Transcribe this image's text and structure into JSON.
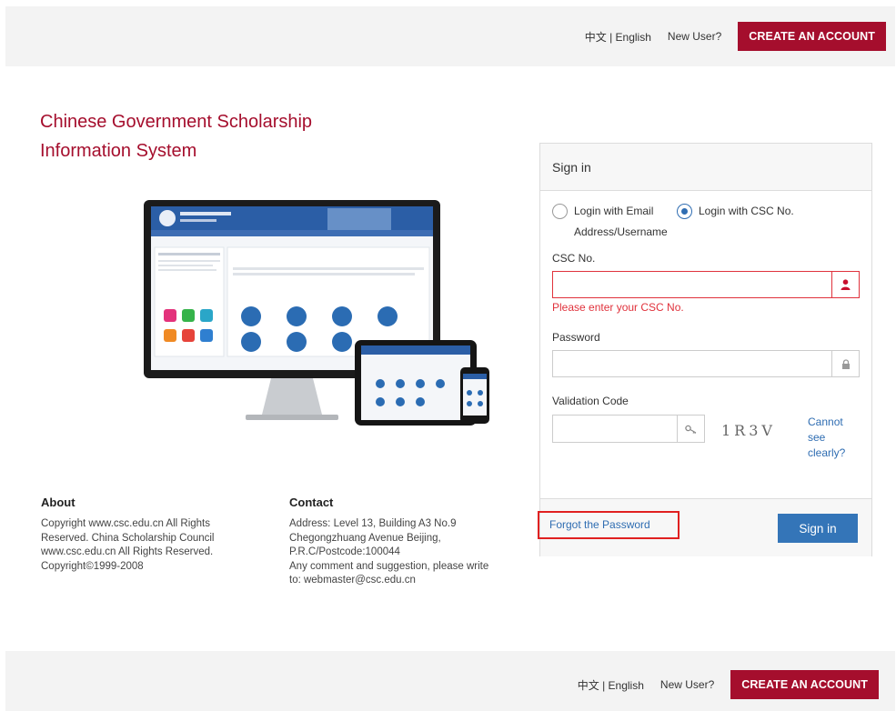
{
  "header": {
    "lang": "中文 | English",
    "new_user": "New User?",
    "create_account": "CREATE AN ACCOUNT"
  },
  "hero": {
    "title_line1": "Chinese Government Scholarship",
    "title_line2": "Information System"
  },
  "signin": {
    "heading": "Sign in",
    "radio_email_line1": "Login with Email",
    "radio_email_line2": "Address/Username",
    "radio_csc": "Login with CSC No.",
    "selected": "csc",
    "csc_label": "CSC No.",
    "csc_value": "",
    "csc_error": "Please enter your CSC No.",
    "password_label": "Password",
    "password_value": "",
    "validation_label": "Validation Code",
    "validation_value": "",
    "captcha_text": "1R3V",
    "cannot_see": "Cannot see clearly?",
    "forgot": "Forgot the Password",
    "signin_button": "Sign in"
  },
  "about": {
    "heading": "About",
    "lines": [
      "Copyright www.csc.edu.cn All Rights",
      "Reserved. China Scholarship Council",
      "www.csc.edu.cn All Rights Reserved.",
      "Copyright©1999-2008"
    ]
  },
  "contact": {
    "heading": "Contact",
    "lines": [
      "Address: Level 13, Building A3 No.9",
      "Chegongzhuang Avenue Beijing,",
      "P.R.C/Postcode:100044",
      "Any comment and suggestion, please write",
      "to: webmaster@csc.edu.cn"
    ]
  },
  "footerbar": {
    "lang": "中文 | English",
    "new_user": "New User?",
    "create_account": "CREATE AN ACCOUNT"
  },
  "colors": {
    "brand_red": "#a50e2d",
    "link_blue": "#2f6db2",
    "button_blue": "#3475b8",
    "error_red": "#e0323c"
  }
}
